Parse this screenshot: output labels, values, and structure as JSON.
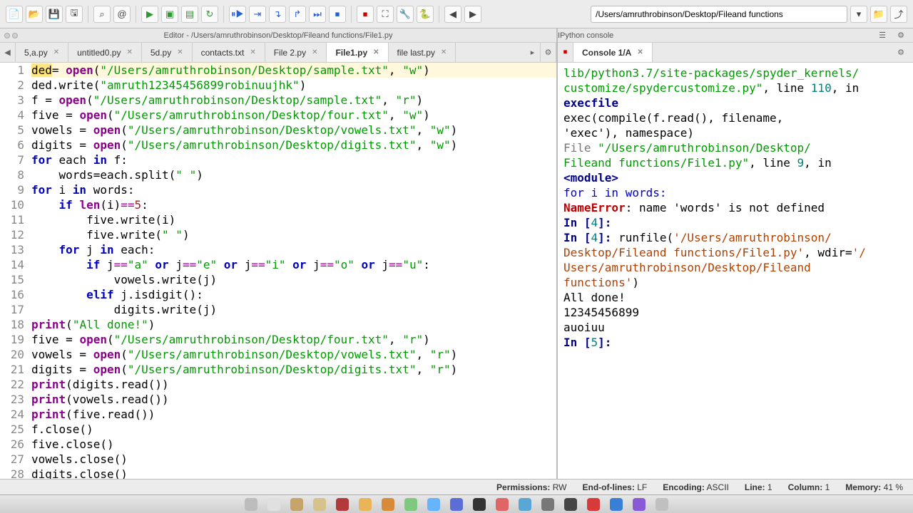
{
  "toolbar": {
    "path": "/Users/amruthrobinson/Desktop/Fileand functions"
  },
  "left": {
    "title": "Editor - /Users/amruthrobinson/Desktop/Fileand functions/File1.py",
    "tabs": [
      "5,a.py",
      "untitled0.py",
      "5d.py",
      "contacts.txt",
      "File 2.py",
      "File1.py",
      "file last.py"
    ],
    "active_tab": 5,
    "code": [
      {
        "n": 1,
        "hl": true,
        "segs": [
          {
            "t": "ded",
            "c": "hl-sel"
          },
          {
            "t": "= "
          },
          {
            "t": "open",
            "c": "builtin"
          },
          {
            "t": "("
          },
          {
            "t": "\"/Users/amruthrobinson/Desktop/sample.txt\"",
            "c": "str"
          },
          {
            "t": ", "
          },
          {
            "t": "\"w\"",
            "c": "str"
          },
          {
            "t": ")"
          }
        ]
      },
      {
        "n": 2,
        "segs": [
          {
            "t": "ded.write("
          },
          {
            "t": "\"amruth12345456899robinuujhk\"",
            "c": "str"
          },
          {
            "t": ")"
          }
        ]
      },
      {
        "n": 3,
        "segs": [
          {
            "t": "f = "
          },
          {
            "t": "open",
            "c": "builtin"
          },
          {
            "t": "("
          },
          {
            "t": "\"/Users/amruthrobinson/Desktop/sample.txt\"",
            "c": "str"
          },
          {
            "t": ", "
          },
          {
            "t": "\"r\"",
            "c": "str"
          },
          {
            "t": ")"
          }
        ]
      },
      {
        "n": 4,
        "segs": [
          {
            "t": "five = "
          },
          {
            "t": "open",
            "c": "builtin"
          },
          {
            "t": "("
          },
          {
            "t": "\"/Users/amruthrobinson/Desktop/four.txt\"",
            "c": "str"
          },
          {
            "t": ", "
          },
          {
            "t": "\"w\"",
            "c": "str"
          },
          {
            "t": ")"
          }
        ]
      },
      {
        "n": 5,
        "segs": [
          {
            "t": "vowels = "
          },
          {
            "t": "open",
            "c": "builtin"
          },
          {
            "t": "("
          },
          {
            "t": "\"/Users/amruthrobinson/Desktop/vowels.txt\"",
            "c": "str"
          },
          {
            "t": ", "
          },
          {
            "t": "\"w\"",
            "c": "str"
          },
          {
            "t": ")"
          }
        ]
      },
      {
        "n": 6,
        "segs": [
          {
            "t": "digits = "
          },
          {
            "t": "open",
            "c": "builtin"
          },
          {
            "t": "("
          },
          {
            "t": "\"/Users/amruthrobinson/Desktop/digits.txt\"",
            "c": "str"
          },
          {
            "t": ", "
          },
          {
            "t": "\"w\"",
            "c": "str"
          },
          {
            "t": ")"
          }
        ]
      },
      {
        "n": 7,
        "segs": [
          {
            "t": "for ",
            "c": "kw"
          },
          {
            "t": "each "
          },
          {
            "t": "in ",
            "c": "kw"
          },
          {
            "t": "f:"
          }
        ]
      },
      {
        "n": 8,
        "segs": [
          {
            "t": "    words=each.split("
          },
          {
            "t": "\" \"",
            "c": "str"
          },
          {
            "t": ")"
          }
        ]
      },
      {
        "n": 9,
        "segs": [
          {
            "t": "for ",
            "c": "kw"
          },
          {
            "t": "i "
          },
          {
            "t": "in ",
            "c": "kw"
          },
          {
            "t": "words:"
          }
        ]
      },
      {
        "n": 10,
        "segs": [
          {
            "t": "    "
          },
          {
            "t": "if ",
            "c": "kw"
          },
          {
            "t": "len",
            "c": "builtin"
          },
          {
            "t": "(i)"
          },
          {
            "t": "==",
            "c": "op"
          },
          {
            "t": "5",
            "c": "num"
          },
          {
            "t": ":"
          }
        ]
      },
      {
        "n": 11,
        "segs": [
          {
            "t": "        five.write(i)"
          }
        ]
      },
      {
        "n": 12,
        "segs": [
          {
            "t": "        five.write("
          },
          {
            "t": "\" \"",
            "c": "str"
          },
          {
            "t": ")"
          }
        ]
      },
      {
        "n": 13,
        "segs": [
          {
            "t": "    "
          },
          {
            "t": "for ",
            "c": "kw"
          },
          {
            "t": "j "
          },
          {
            "t": "in ",
            "c": "kw"
          },
          {
            "t": "each:"
          }
        ]
      },
      {
        "n": 14,
        "segs": [
          {
            "t": "        "
          },
          {
            "t": "if ",
            "c": "kw"
          },
          {
            "t": "j"
          },
          {
            "t": "==",
            "c": "op"
          },
          {
            "t": "\"a\"",
            "c": "str"
          },
          {
            "t": " "
          },
          {
            "t": "or ",
            "c": "kw"
          },
          {
            "t": "j"
          },
          {
            "t": "==",
            "c": "op"
          },
          {
            "t": "\"e\"",
            "c": "str"
          },
          {
            "t": " "
          },
          {
            "t": "or ",
            "c": "kw"
          },
          {
            "t": "j"
          },
          {
            "t": "==",
            "c": "op"
          },
          {
            "t": "\"i\"",
            "c": "str"
          },
          {
            "t": " "
          },
          {
            "t": "or ",
            "c": "kw"
          },
          {
            "t": "j"
          },
          {
            "t": "==",
            "c": "op"
          },
          {
            "t": "\"o\"",
            "c": "str"
          },
          {
            "t": " "
          },
          {
            "t": "or ",
            "c": "kw"
          },
          {
            "t": "j"
          },
          {
            "t": "==",
            "c": "op"
          },
          {
            "t": "\"u\"",
            "c": "str"
          },
          {
            "t": ":"
          }
        ]
      },
      {
        "n": 15,
        "segs": [
          {
            "t": "            vowels.write(j)"
          }
        ]
      },
      {
        "n": 16,
        "segs": [
          {
            "t": "        "
          },
          {
            "t": "elif ",
            "c": "kw"
          },
          {
            "t": "j.isdigit():"
          }
        ]
      },
      {
        "n": 17,
        "segs": [
          {
            "t": "            digits.write(j)"
          }
        ]
      },
      {
        "n": 18,
        "segs": [
          {
            "t": "print",
            "c": "builtin"
          },
          {
            "t": "("
          },
          {
            "t": "\"All done!\"",
            "c": "str"
          },
          {
            "t": ")"
          }
        ]
      },
      {
        "n": 19,
        "segs": [
          {
            "t": "five = "
          },
          {
            "t": "open",
            "c": "builtin"
          },
          {
            "t": "("
          },
          {
            "t": "\"/Users/amruthrobinson/Desktop/four.txt\"",
            "c": "str"
          },
          {
            "t": ", "
          },
          {
            "t": "\"r\"",
            "c": "str"
          },
          {
            "t": ")"
          }
        ]
      },
      {
        "n": 20,
        "segs": [
          {
            "t": "vowels = "
          },
          {
            "t": "open",
            "c": "builtin"
          },
          {
            "t": "("
          },
          {
            "t": "\"/Users/amruthrobinson/Desktop/vowels.txt\"",
            "c": "str"
          },
          {
            "t": ", "
          },
          {
            "t": "\"r\"",
            "c": "str"
          },
          {
            "t": ")"
          }
        ]
      },
      {
        "n": 21,
        "segs": [
          {
            "t": "digits = "
          },
          {
            "t": "open",
            "c": "builtin"
          },
          {
            "t": "("
          },
          {
            "t": "\"/Users/amruthrobinson/Desktop/digits.txt\"",
            "c": "str"
          },
          {
            "t": ", "
          },
          {
            "t": "\"r\"",
            "c": "str"
          },
          {
            "t": ")"
          }
        ]
      },
      {
        "n": 22,
        "segs": [
          {
            "t": "print",
            "c": "builtin"
          },
          {
            "t": "(digits.read())"
          }
        ]
      },
      {
        "n": 23,
        "segs": [
          {
            "t": "print",
            "c": "builtin"
          },
          {
            "t": "(vowels.read())"
          }
        ]
      },
      {
        "n": 24,
        "segs": [
          {
            "t": "print",
            "c": "builtin"
          },
          {
            "t": "(five.read())"
          }
        ]
      },
      {
        "n": 25,
        "segs": [
          {
            "t": "f.close()"
          }
        ]
      },
      {
        "n": 26,
        "segs": [
          {
            "t": "five.close()"
          }
        ]
      },
      {
        "n": 27,
        "segs": [
          {
            "t": "vowels.close()"
          }
        ]
      },
      {
        "n": 28,
        "segs": [
          {
            "t": "digits.close()"
          }
        ]
      }
    ]
  },
  "right": {
    "title": "IPython console",
    "tab": "Console 1/A",
    "lines": [
      [
        {
          "t": "lib/python3.7/site-packages/spyder_kernels/",
          "c": "c-path"
        }
      ],
      [
        {
          "t": "customize/spydercustomize.py\"",
          "c": "c-path"
        },
        {
          "t": ", line "
        },
        {
          "t": "110",
          "c": "c-num"
        },
        {
          "t": ", in "
        }
      ],
      [
        {
          "t": "execfile",
          "c": "c-blue"
        }
      ],
      [
        {
          "t": "    exec(compile(f.read(), filename,"
        }
      ],
      [
        {
          "t": "'exec'), namespace)"
        }
      ],
      [
        {
          "t": " "
        }
      ],
      [
        {
          "t": "  File ",
          "c": "c-gray"
        },
        {
          "t": "\"/Users/amruthrobinson/Desktop/",
          "c": "c-path"
        }
      ],
      [
        {
          "t": "Fileand functions/File1.py\"",
          "c": "c-path"
        },
        {
          "t": ", line "
        },
        {
          "t": "9",
          "c": "c-num"
        },
        {
          "t": ", in "
        }
      ],
      [
        {
          "t": "<module>",
          "c": "c-blue"
        }
      ],
      [
        {
          "t": "    for i in words:",
          "c": "c-kw"
        }
      ],
      [
        {
          "t": " "
        }
      ],
      [
        {
          "t": "NameError",
          "c": "c-red"
        },
        {
          "t": ": name 'words' is not defined"
        }
      ],
      [
        {
          "t": " "
        }
      ],
      [
        {
          "t": " "
        }
      ],
      [
        {
          "t": "In [",
          "c": "c-blue"
        },
        {
          "t": "4",
          "c": "c-num"
        },
        {
          "t": "]: ",
          "c": "c-blue"
        }
      ],
      [
        {
          "t": " "
        }
      ],
      [
        {
          "t": "In [",
          "c": "c-blue"
        },
        {
          "t": "4",
          "c": "c-num"
        },
        {
          "t": "]: ",
          "c": "c-blue"
        },
        {
          "t": "runfile("
        },
        {
          "t": "'/Users/amruthrobinson/",
          "c": "c-str"
        }
      ],
      [
        {
          "t": "Desktop/Fileand functions/File1.py'",
          "c": "c-str"
        },
        {
          "t": ", wdir="
        },
        {
          "t": "'/",
          "c": "c-str"
        }
      ],
      [
        {
          "t": "Users/amruthrobinson/Desktop/Fileand ",
          "c": "c-str"
        }
      ],
      [
        {
          "t": "functions'",
          "c": "c-str"
        },
        {
          "t": ")"
        }
      ],
      [
        {
          "t": "All done!"
        }
      ],
      [
        {
          "t": "12345456899"
        }
      ],
      [
        {
          "t": "auoiuu"
        }
      ],
      [
        {
          "t": " "
        }
      ],
      [
        {
          "t": " "
        }
      ],
      [
        {
          "t": "In [",
          "c": "c-blue"
        },
        {
          "t": "5",
          "c": "c-num"
        },
        {
          "t": "]: ",
          "c": "c-blue"
        }
      ]
    ]
  },
  "status": {
    "permissions_label": "Permissions:",
    "permissions_val": "RW",
    "eol_label": "End-of-lines:",
    "eol_val": "LF",
    "encoding_label": "Encoding:",
    "encoding_val": "ASCII",
    "line_label": "Line:",
    "line_val": "1",
    "col_label": "Column:",
    "col_val": "1",
    "mem_label": "Memory:",
    "mem_val": "41 %"
  },
  "dock_colors": [
    "#bdbdbd",
    "#e0e0e0",
    "#c7a56a",
    "#d6c28a",
    "#b33a3a",
    "#eab45a",
    "#d68a3a",
    "#7fc97f",
    "#66b3ff",
    "#5a6ed6",
    "#333333",
    "#e06666",
    "#5aa7d6",
    "#777",
    "#444",
    "#d63a3a",
    "#3a7fd6",
    "#8a5ad6",
    "#c0c0c0"
  ]
}
